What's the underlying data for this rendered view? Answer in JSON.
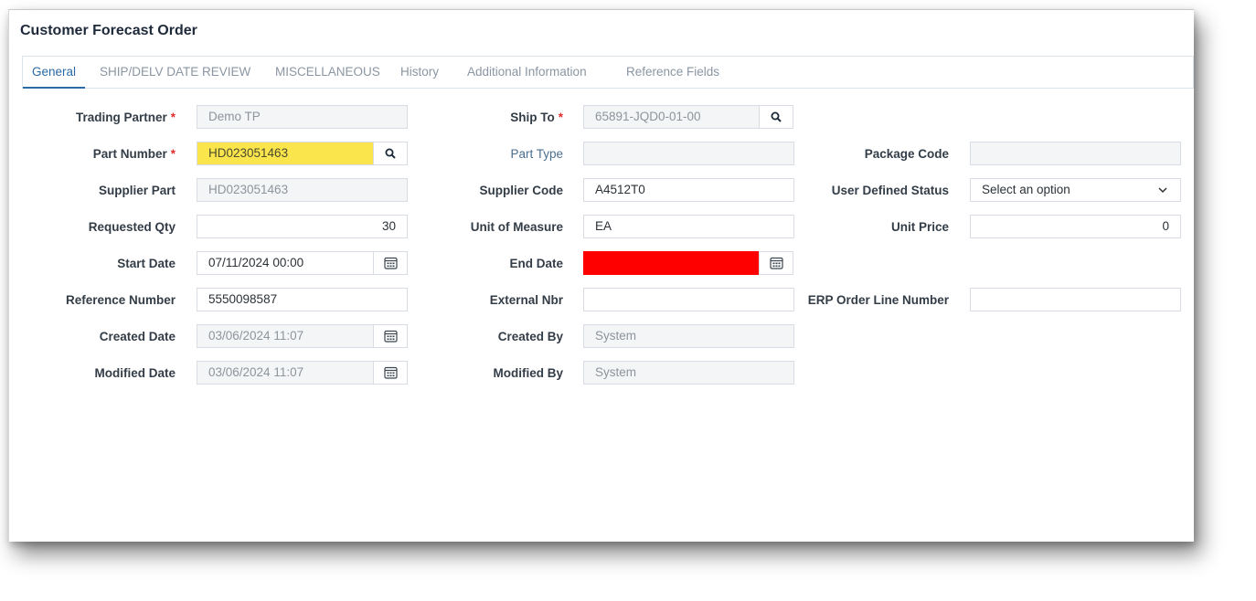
{
  "window": {
    "title": "Customer Forecast Order"
  },
  "tabs": [
    {
      "label": "General",
      "active": true
    },
    {
      "label": "SHIP/DELV DATE REVIEW",
      "active": false
    },
    {
      "label": "MISCELLANEOUS",
      "active": false
    },
    {
      "label": "History",
      "active": false
    },
    {
      "label": "Additional Information",
      "active": false
    },
    {
      "label": "Reference Fields",
      "active": false
    }
  ],
  "colors": {
    "accent": "#2a6aa5",
    "required_marker": "#e03030",
    "highlight_yellow": "#fbe54d",
    "error_red": "#ff0000"
  },
  "form": {
    "required_marker": "*",
    "trading_partner": {
      "label": "Trading Partner",
      "value": "Demo TP"
    },
    "ship_to": {
      "label": "Ship To",
      "value": "65891-JQD0-01-00"
    },
    "part_number": {
      "label": "Part Number",
      "value": "HD023051463"
    },
    "part_type": {
      "label": "Part Type",
      "value": ""
    },
    "package_code": {
      "label": "Package Code",
      "value": ""
    },
    "supplier_part": {
      "label": "Supplier Part",
      "value": "HD023051463"
    },
    "supplier_code": {
      "label": "Supplier Code",
      "value": "A4512T0"
    },
    "user_defined_status": {
      "label": "User Defined Status",
      "placeholder": "Select an option"
    },
    "requested_qty": {
      "label": "Requested Qty",
      "value": "30"
    },
    "unit_of_measure": {
      "label": "Unit of Measure",
      "value": "EA"
    },
    "unit_price": {
      "label": "Unit Price",
      "value": "0"
    },
    "start_date": {
      "label": "Start Date",
      "value": "07/11/2024 00:00"
    },
    "end_date": {
      "label": "End Date",
      "value": ""
    },
    "reference_number": {
      "label": "Reference Number",
      "value": "5550098587"
    },
    "external_nbr": {
      "label": "External Nbr",
      "value": ""
    },
    "erp_order_line_number": {
      "label": "ERP Order Line Number",
      "value": ""
    },
    "created_date": {
      "label": "Created Date",
      "value": "03/06/2024 11:07"
    },
    "created_by": {
      "label": "Created By",
      "value": "System"
    },
    "modified_date": {
      "label": "Modified Date",
      "value": "03/06/2024 11:07"
    },
    "modified_by": {
      "label": "Modified By",
      "value": "System"
    }
  },
  "icons": {
    "search": "search-icon",
    "calendar": "calendar-icon",
    "dropdown": "chevron-down-icon"
  }
}
